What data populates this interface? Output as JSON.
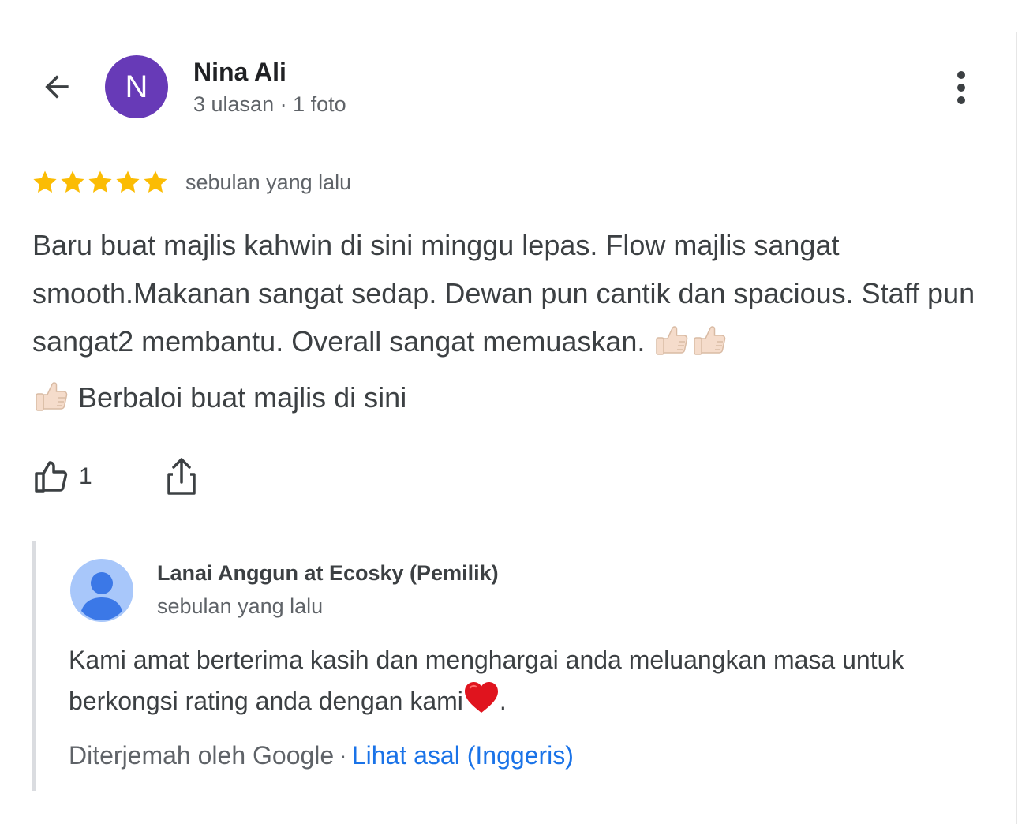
{
  "header": {
    "back_icon": "arrow-back-icon",
    "avatar_letter": "N",
    "avatar_color": "#673ab7",
    "name": "Nina Ali",
    "meta": "3 ulasan · 1 foto",
    "more_icon": "more-vert-icon"
  },
  "review": {
    "rating": 5,
    "rating_max": 5,
    "star_color": "#fbbc04",
    "date": "sebulan yang lalu",
    "text_part1": "Baru buat majlis kahwin di sini minggu lepas. Flow majlis sangat smooth.Makanan sangat sedap. Dewan pun cantik dan spacious. Staff pun sangat2 membantu. Overall sangat memuaskan. ",
    "text_part2": " Berbaloi buat majlis di sini",
    "emoji_icon": "thumbs-up-emoji",
    "like_icon": "thumb-up-icon",
    "like_count": "1",
    "share_icon": "share-icon"
  },
  "owner_reply": {
    "avatar_icon": "person-avatar-icon",
    "name": "Lanai Anggun at Ecosky (Pemilik)",
    "date": "sebulan yang lalu",
    "text_part1": "Kami amat berterima kasih dan menghargai anda meluangkan masa untuk berkongsi rating anda dengan kami",
    "heart_icon": "red-heart-emoji",
    "text_part2": ".",
    "translated_label": "Diterjemah oleh Google",
    "separator": "·",
    "see_original_label": "Lihat asal (Inggeris)",
    "link_color": "#1a73e8"
  }
}
